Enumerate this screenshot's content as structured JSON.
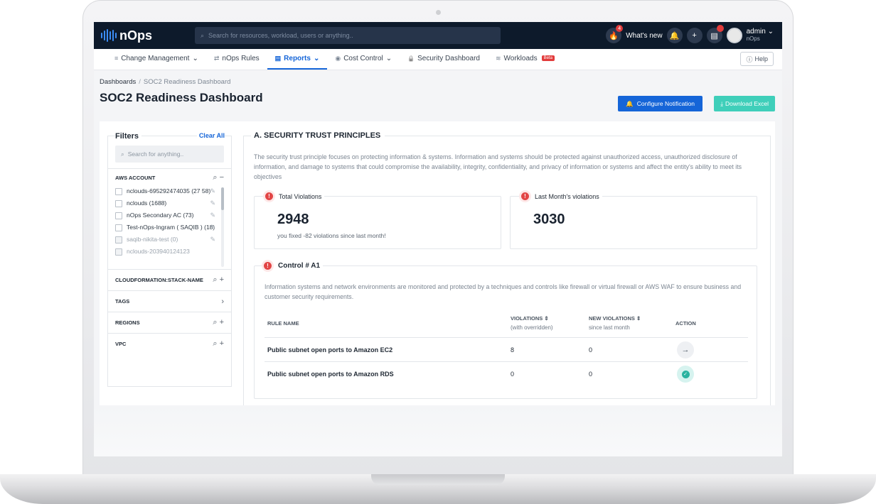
{
  "app": {
    "logo_text": "nOps",
    "search_placeholder": "Search for resources, workload, users or anything..",
    "whats_new": "What's new",
    "fire_badge": "4",
    "user_name": "admin",
    "user_org": "nOps"
  },
  "nav": {
    "items": [
      {
        "label": "Change Management",
        "icon": "≡",
        "caret": "⌄"
      },
      {
        "label": "nOps Rules",
        "icon": "⇄",
        "caret": ""
      },
      {
        "label": "Reports",
        "icon": "▤",
        "caret": "⌄"
      },
      {
        "label": "Cost Control",
        "icon": "◉",
        "caret": "⌄"
      },
      {
        "label": "Security Dashboard",
        "icon": "🔒",
        "caret": ""
      },
      {
        "label": "Workloads",
        "icon": "≋",
        "caret": "",
        "badge": "Beta"
      }
    ],
    "active_index": 2,
    "help_label": "Help"
  },
  "page": {
    "breadcrumb_root": "Dashboards",
    "breadcrumb_current": "SOC2 Readiness Dashboard",
    "title": "SOC2 Readiness Dashboard",
    "configure_label": "Configure Notification",
    "download_label": "Download Excel"
  },
  "filters": {
    "title": "Filters",
    "clear_all": "Clear All",
    "search_placeholder": "Search for anything..",
    "aws_account_label": "AWS ACCOUNT",
    "accounts": [
      {
        "label": "nclouds-695292474035 (27 58)",
        "dim": false
      },
      {
        "label": "nclouds (1688)",
        "dim": false
      },
      {
        "label": "nOps Secondary AC (73)",
        "dim": false
      },
      {
        "label": "Test-nOps-Ingram ( SAQIB ) (18)",
        "dim": false
      },
      {
        "label": "saqib-nikita-test (0)",
        "dim": true
      },
      {
        "label": "nclouds-203940124123",
        "dim": true
      }
    ],
    "sections": [
      {
        "label": "CLOUDFORMATION:STACK-NAME",
        "icon": "⌕ +"
      },
      {
        "label": "TAGS",
        "icon": "›"
      },
      {
        "label": "REGIONS",
        "icon": "⌕ +"
      },
      {
        "label": "VPC",
        "icon": "⌕ +"
      }
    ]
  },
  "principles": {
    "title": "A. SECURITY TRUST PRINCIPLES",
    "description": "The security trust principle focuses on protecting information & systems. Information and systems should be protected against unauthorized access, unauthorized disclosure of information, and damage to systems that could compromise the availability, integrity, confidentiality, and privacy of information or systems and affect the entity's ability to meet its objectives",
    "total_violations_label": "Total Violations",
    "total_violations_value": "2948",
    "total_violations_sub": "you fixed -82 violations since last month!",
    "last_month_label": "Last Month's violations",
    "last_month_value": "3030"
  },
  "control": {
    "label": "Control # A1",
    "description": "Information systems and network environments are monitored and protected by a techniques and controls like firewall or virtual firewall or AWS WAF to ensure business and customer security requirements.",
    "columns": {
      "rule": "RULE NAME",
      "violations": "VIOLATIONS ⇕",
      "violations_sub": "(with overridden)",
      "new_violations": "NEW VIOLATIONS ⇕",
      "new_violations_sub": "since last month",
      "action": "ACTION"
    },
    "rows": [
      {
        "rule": "Public subnet open ports to Amazon EC2",
        "violations": "8",
        "new": "0",
        "action": "arrow"
      },
      {
        "rule": "Public subnet open ports to Amazon RDS",
        "violations": "0",
        "new": "0",
        "action": "check"
      }
    ]
  },
  "colors": {
    "topbar": "#0d1a2b",
    "accent": "#1565d8",
    "teal": "#3fcfba",
    "danger": "#e24545"
  }
}
